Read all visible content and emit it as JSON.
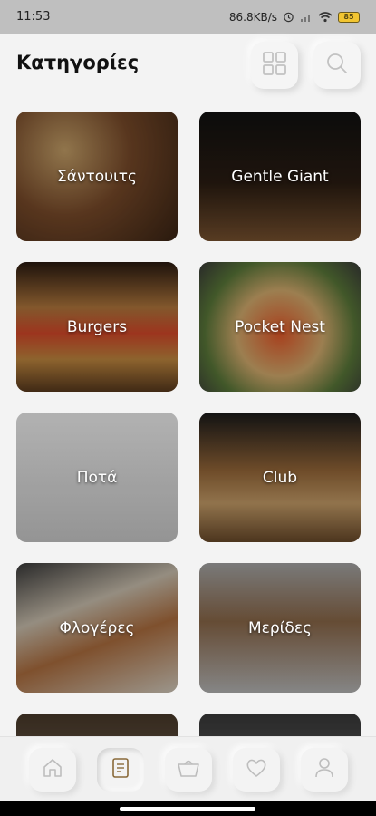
{
  "status_bar": {
    "time": "11:53",
    "network_speed": "86.8KB/s",
    "battery": "85"
  },
  "header": {
    "title": "Κατηγορίες",
    "grid_icon": "grid-icon",
    "search_icon": "search-icon"
  },
  "categories": [
    {
      "label": "Σάντουιτς"
    },
    {
      "label": "Gentle Giant"
    },
    {
      "label": "Burgers"
    },
    {
      "label": "Pocket Nest"
    },
    {
      "label": "Ποτά"
    },
    {
      "label": "Club"
    },
    {
      "label": "Φλογέρες"
    },
    {
      "label": "Μερίδες"
    }
  ],
  "bottom_nav": {
    "items": [
      "home-icon",
      "menu-icon",
      "cart-icon",
      "heart-icon",
      "user-icon"
    ],
    "active": "menu-icon"
  }
}
